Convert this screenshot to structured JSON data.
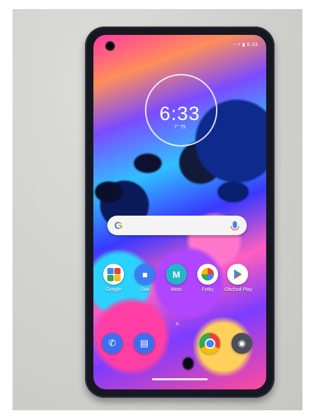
{
  "status": {
    "time": "6:33"
  },
  "clock": {
    "time": "6:33",
    "weather": "7° 79"
  },
  "search": {
    "logo": "G"
  },
  "apps": [
    {
      "name": "google-folder",
      "label": "Google"
    },
    {
      "name": "duo",
      "label": "Duo"
    },
    {
      "name": "moto",
      "label": "Moto"
    },
    {
      "name": "photos",
      "label": "Fotky"
    },
    {
      "name": "play-store",
      "label": "Obchod Play"
    }
  ],
  "dock": [
    "phone",
    "messages",
    "chrome",
    "camera"
  ]
}
